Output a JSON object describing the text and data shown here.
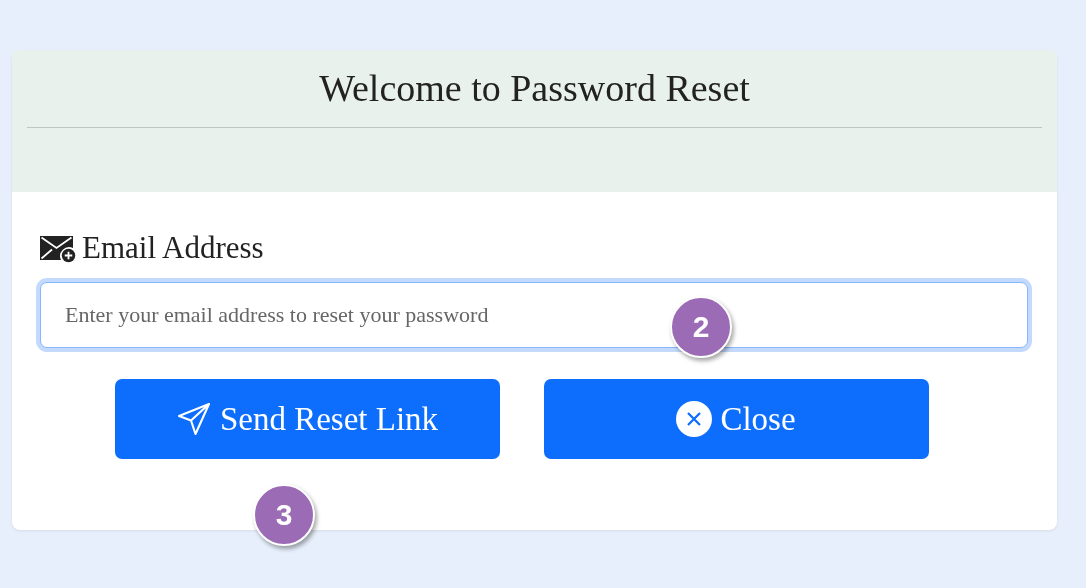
{
  "dialog": {
    "title": "Welcome to Password Reset",
    "field": {
      "label": "Email Address",
      "placeholder": "Enter your email address to reset your password",
      "focused": true
    },
    "buttons": [
      {
        "kind": "send",
        "label": "Send Reset Link"
      },
      {
        "kind": "close",
        "label": "Close"
      }
    ]
  },
  "markers": [
    "2",
    "3"
  ]
}
